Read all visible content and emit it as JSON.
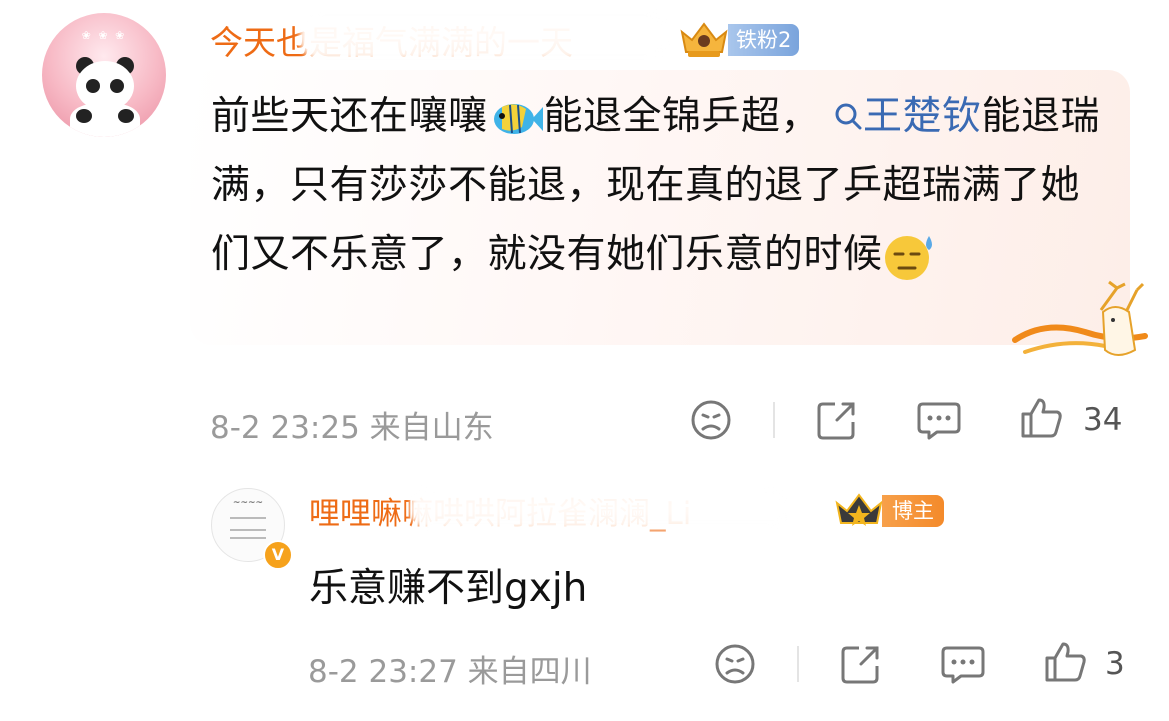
{
  "main_comment": {
    "username": "今天也是福气满满的一天",
    "fan_badge": "铁粉2",
    "text_before": "前些天还在嚷嚷",
    "text_after_emoji": "能退全锦乒超，",
    "topic_icon": "search-icon",
    "topic": "王楚钦",
    "text_rest": "能退瑞满，只有莎莎不能退，现在真的退了乒超瑞满了她们又不乐意了，就没有她们乐意的时候",
    "meta": "8-2 23:25 来自山东",
    "like_count": "34"
  },
  "reply": {
    "username": "哩哩嘛嘛哄哄阿拉雀澜澜_Li",
    "author_badge": "博主",
    "text": "乐意赚不到gxjh",
    "meta": "8-2 23:27 来自四川",
    "like_count": "3"
  },
  "colors": {
    "username": "#ee6b15",
    "topic_link": "#3a6ab3",
    "meta_gray": "#9a9a9a",
    "fan_badge_bg": "#8fb3e3",
    "author_badge_bg": "#f59a3a"
  }
}
